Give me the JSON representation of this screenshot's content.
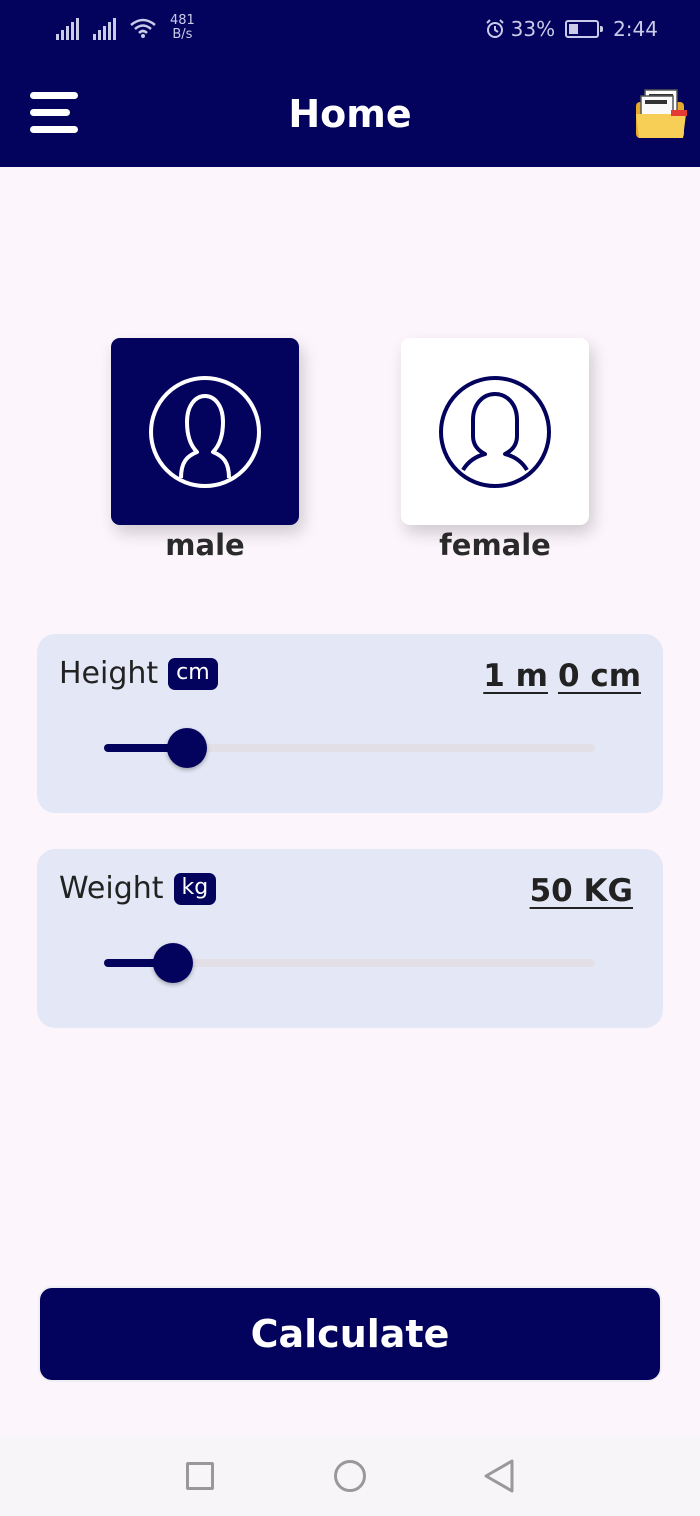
{
  "status_bar": {
    "net_speed_value": "481",
    "net_speed_unit": "B/s",
    "battery": "33%",
    "time": "2:44"
  },
  "header": {
    "title": "Home",
    "icons": [
      "menu-icon",
      "folder-icon"
    ]
  },
  "gender": {
    "male_label": "male",
    "female_label": "female",
    "selected": "male"
  },
  "height": {
    "label": "Height",
    "unit": "cm",
    "value_m": "1 m",
    "value_cm": "0 cm",
    "slider_fraction": 0.17
  },
  "weight": {
    "label": "Weight",
    "unit": "kg",
    "value": "50 KG",
    "slider_fraction": 0.14
  },
  "calculate_label": "Calculate",
  "colors": {
    "primary": "#03035e",
    "background": "#fcf6fc",
    "card": "#e4e8f6"
  }
}
